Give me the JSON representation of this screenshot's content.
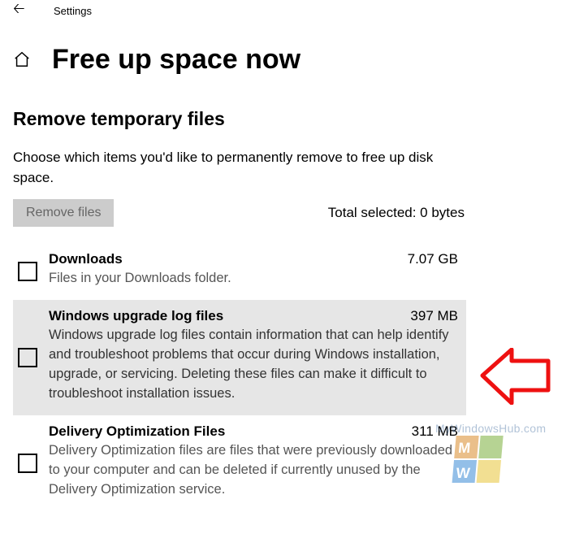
{
  "header": {
    "settings_label": "Settings"
  },
  "title": "Free up space now",
  "section_heading": "Remove temporary files",
  "intro": "Choose which items you'd like to permanently remove to free up disk space.",
  "remove_button": "Remove files",
  "total_selected_label": "Total selected: 0 bytes",
  "items": [
    {
      "name": "Downloads",
      "size": "7.07 GB",
      "description": "Files in your Downloads folder.",
      "selected": false
    },
    {
      "name": "Windows upgrade log files",
      "size": "397 MB",
      "description": "Windows upgrade log files contain information that can help identify and troubleshoot problems that occur during Windows installation, upgrade, or servicing.  Deleting these files can make it difficult to troubleshoot installation issues.",
      "selected": true
    },
    {
      "name": "Delivery Optimization Files",
      "size": "311 MB",
      "description": "Delivery Optimization files are files that were previously downloaded to your computer and can be deleted if currently unused by the Delivery Optimization service.",
      "selected": false
    }
  ],
  "watermark": "MyWindowsHub.com"
}
